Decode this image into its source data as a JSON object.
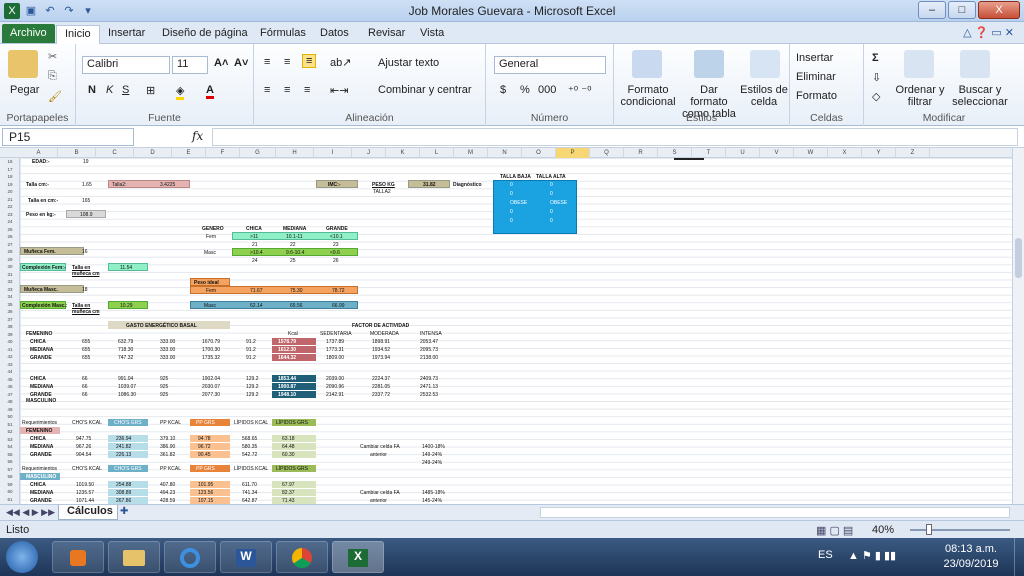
{
  "window": {
    "title": "Job Morales Guevara - Microsoft Excel",
    "minimize": "–",
    "maximize": "□",
    "close": "X"
  },
  "tabs": [
    "Archivo",
    "Inicio",
    "Insertar",
    "Diseño de página",
    "Fórmulas",
    "Datos",
    "Revisar",
    "Vista"
  ],
  "ribbon": {
    "paste": "Pegar",
    "clipboard": "Portapapeles",
    "font_name": "Calibri",
    "font_size": "11",
    "font_group": "Fuente",
    "bold": "N",
    "italic": "K",
    "underline": "S",
    "wrap": "Ajustar texto",
    "merge": "Combinar y centrar",
    "align_group": "Alineación",
    "number_format": "General",
    "percent": "%",
    "thousands": "000",
    "number_group": "Número",
    "cond_format": "Formato condicional",
    "table_format": "Dar formato como tabla",
    "cell_styles": "Estilos de celda",
    "styles_group": "Estilos",
    "insert": "Insertar",
    "delete": "Eliminar",
    "format": "Formato",
    "cells_group": "Celdas",
    "sort": "Ordenar y filtrar",
    "find": "Buscar y seleccionar",
    "modify_group": "Modificar"
  },
  "formula_bar": {
    "name_box": "P15",
    "fx": "fx",
    "formula": ""
  },
  "columns": [
    "A",
    "B",
    "C",
    "D",
    "E",
    "F",
    "G",
    "H",
    "I",
    "J",
    "K",
    "L",
    "M",
    "N",
    "O",
    "P",
    "Q",
    "R",
    "S",
    "T",
    "U",
    "V",
    "W",
    "X",
    "Y",
    "Z"
  ],
  "rows": [
    "16",
    "17",
    "18",
    "19",
    "20",
    "21",
    "22",
    "23",
    "24",
    "25",
    "26",
    "27",
    "28",
    "29",
    "30",
    "31",
    "32",
    "33",
    "34",
    "35",
    "36",
    "37",
    "38",
    "39",
    "40",
    "41",
    "42",
    "43",
    "44",
    "45",
    "46",
    "47",
    "48",
    "49",
    "50",
    "51",
    "52",
    "53",
    "54",
    "55",
    "56",
    "57",
    "58",
    "59",
    "60",
    "61"
  ],
  "cells": {
    "edad_l": "EDAD:-",
    "edad_v": "19",
    "talla_l": "Talla cm:-",
    "talla_v": "1.65",
    "talla2_l": "Talla2:",
    "talla2_v": "3.4225",
    "imc_l": "IMC:-",
    "imc_v": "31.82",
    "imc_dx": "Diagnóstico",
    "peso_kg": "PESO KG",
    "talla2b": "TALLA2",
    "tallacm_l": "Talla en cm:-",
    "tallacm_v": "165",
    "pesoreal_l": "Peso en kg:-",
    "pesoreal_v": "108.9",
    "tbaja": "TALLA BAJA",
    "talta": "TALLA ALTA",
    "mu_fem_l": "Muñeca Fem.",
    "mu_fem_v": "16",
    "compl_fem_l": "Complexión Fem:-",
    "compl_fem_c": "Talla en muñeca cm",
    "compl_fem_v": "11.54",
    "mu_masc_l": "Muñeca Masc.",
    "mu_masc_v": "18",
    "compl_masc_l": "Complexión Masc.:",
    "compl_masc_c": "Talla en muñeca cm",
    "compl_masc_v": "10.29",
    "genero": "GENERO",
    "chica": "CHICA",
    "mediana": "MEDIANA",
    "grande": "GRANDE",
    "fem": "Fem",
    "masc": "Masc",
    "f1": ">11",
    "f2": "10.1-11",
    "f3": "<10.1",
    "n21": "21",
    "n22": "22",
    "n23": "23",
    "m1": ">10.4",
    "m2": "9.6-10.4",
    "m3": "<9.6",
    "n24": "24",
    "n25": "25",
    "n26": "26",
    "pes_ideal": "Peso ideal",
    "pi_fem": "Fem",
    "pi_f1": "71.67",
    "pi_f2": "75.30",
    "pi_f3": "78.72",
    "pi_masc": "Masc",
    "pi_m1": "62.14",
    "pi_m2": "65.56",
    "pi_m3": "66.99",
    "geb": "GASTO ENERGÉTICO BASAL",
    "factor": "FACTOR DE ACTIVIDAD",
    "kcal": "Kcal",
    "sed": "SEDENTARIA",
    "mod": "MODERADA",
    "int": "INTENSA",
    "femenino": "FEMENINO",
    "masculino": "MASCULINO",
    "req": "Requerimientos",
    "cho_kcal": "CHO'S KCAL",
    "cho_grs": "CHO'S GRS",
    "pp_kcal": "PP KCAL",
    "pp_grs": "PP GRS",
    "lip_kcal": "LÍPIDOS KCAL",
    "lip_grs": "LÍPIDOS GRS",
    "cambiar": "Cambiar celda FA",
    "anterior": "anterior",
    "r1": "1400-18%",
    "r2": "149-24%",
    "r3": "249-24%",
    "r4": "1485-18%",
    "r5": "145-24%"
  },
  "geb_fem": [
    {
      "l": "CHICA",
      "a": "655",
      "b": "632.79",
      "c": "333.00",
      "d": "1670.79",
      "e": "91.2",
      "k": "1578.79",
      "s": "1737.89",
      "m": "1898.91",
      "i": "2053.47"
    },
    {
      "l": "MEDIANA",
      "a": "655",
      "b": "718.30",
      "c": "333.00",
      "d": "1700.30",
      "e": "91.2",
      "k": "1612.30",
      "s": "1773.31",
      "m": "1934.52",
      "i": "2095.73"
    },
    {
      "l": "GRANDE",
      "a": "655",
      "b": "747.32",
      "c": "333.00",
      "d": "1735.32",
      "e": "91.2",
      "k": "1644.32",
      "s": "1809.00",
      "m": "1973.94",
      "i": "2138.00"
    }
  ],
  "geb_masc": [
    {
      "l": "CHICA",
      "a": "66",
      "b": "991.04",
      "c": "925",
      "d": "1902.04",
      "e": "129.2",
      "k": "1853.44",
      "s": "2039.00",
      "m": "2224.37",
      "i": "2409.73"
    },
    {
      "l": "MEDIANA",
      "a": "66",
      "b": "1039.07",
      "c": "925",
      "d": "2030.07",
      "e": "129.2",
      "k": "1900.87",
      "s": "2090.96",
      "m": "2281.05",
      "i": "2471.13"
    },
    {
      "l": "GRANDE",
      "a": "66",
      "b": "1086.30",
      "c": "925",
      "d": "2077.30",
      "e": "129.2",
      "k": "1948.10",
      "s": "2142.91",
      "m": "2337.72",
      "i": "2532.53"
    }
  ],
  "req_fem": [
    {
      "l": "CHICA",
      "a": "947.75",
      "b": "236.94",
      "c": "379.10",
      "d": "94.78",
      "e": "568.65",
      "f": "63.18"
    },
    {
      "l": "MEDIANA",
      "a": "967.26",
      "b": "241.82",
      "c": "386.90",
      "d": "96.72",
      "e": "580.35",
      "f": "64.48"
    },
    {
      "l": "GRANDE",
      "a": "904.54",
      "b": "226.13",
      "c": "361.82",
      "d": "90.45",
      "e": "542.72",
      "f": "60.30"
    }
  ],
  "req_masc": [
    {
      "l": "CHICA",
      "a": "1019.50",
      "b": "254.88",
      "c": "407.80",
      "d": "101.95",
      "e": "611.70",
      "f": "67.97"
    },
    {
      "l": "MEDIANA",
      "a": "1235.57",
      "b": "308.89",
      "c": "494.23",
      "d": "123.56",
      "e": "741.34",
      "f": "82.37"
    },
    {
      "l": "GRANDE",
      "a": "1071.44",
      "b": "267.86",
      "c": "428.59",
      "d": "107.15",
      "e": "642.87",
      "f": "71.43"
    }
  ],
  "diag": [
    "0",
    "0",
    "0",
    "0",
    "OBESE",
    "OBESE",
    "0",
    "0",
    "0",
    "0"
  ],
  "sheet": {
    "name": "Cálculos",
    "status": "Listo",
    "zoom": "40%"
  },
  "taskbar": {
    "lang": "ES",
    "time": "08:13 a.m.",
    "date": "23/09/2019"
  }
}
